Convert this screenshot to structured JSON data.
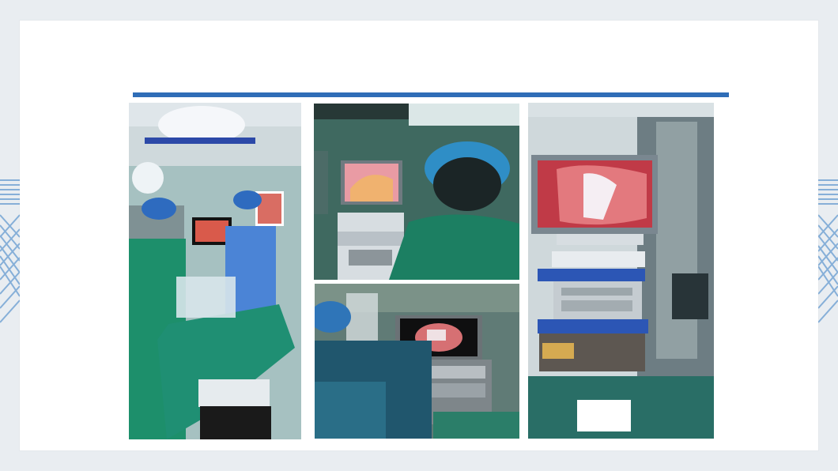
{
  "colors": {
    "background": "#e9edf1",
    "slide": "#ffffff",
    "accent_rule": "#2f6db7",
    "deco_lines": "#86afd8"
  },
  "photos": [
    {
      "subject": "surgeons-operating-room"
    },
    {
      "subject": "surgeon-viewing-endoscope-monitor"
    },
    {
      "subject": "surgeon-with-endoscopy-tower"
    },
    {
      "subject": "endoscopy-cart-monitor"
    }
  ]
}
